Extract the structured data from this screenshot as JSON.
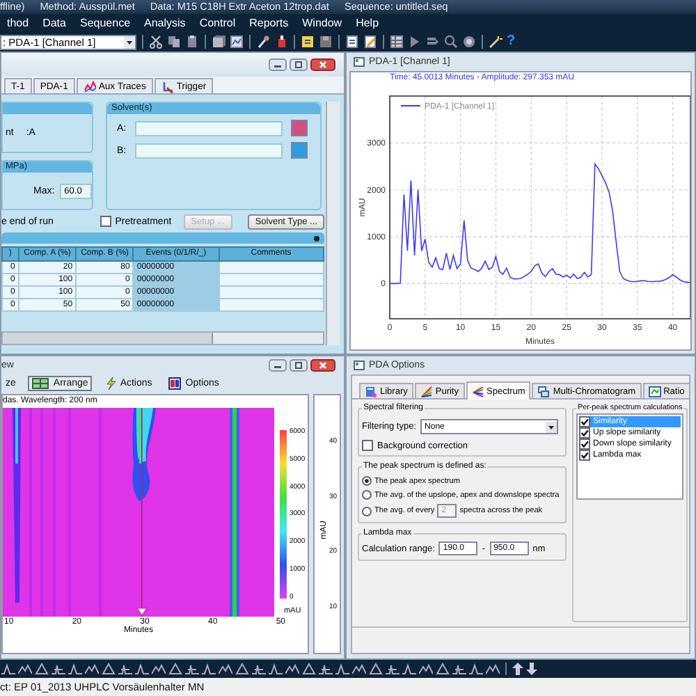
{
  "title_bar": {
    "segments": [
      "ffline)",
      "Method: Ausspül.met",
      "Data: M15 C18H Extr Aceton 12trop.dat",
      "Sequence: untitled.seq"
    ]
  },
  "menu": [
    "thod",
    "Data",
    "Sequence",
    "Analysis",
    "Control",
    "Reports",
    "Window",
    "Help"
  ],
  "toolbar": {
    "channel": ": PDA-1 [Channel 1]",
    "help": "?"
  },
  "method_window": {
    "tabs": [
      {
        "label": "T-1",
        "kind": "plain",
        "selected": false
      },
      {
        "label": "PDA-1",
        "kind": "plain",
        "selected": false
      },
      {
        "label": "Aux Traces",
        "kind": "traces",
        "selected": false
      },
      {
        "label": "Trigger",
        "kind": "trigger",
        "selected": false
      }
    ],
    "eluent": {
      "label": "nt",
      "value": ":A"
    },
    "pressure": {
      "header": "MPa)",
      "max_label": "Max:",
      "max_value": "60.0"
    },
    "solvents": {
      "header": "Solvent(s)",
      "rows": [
        {
          "label": "A:",
          "color": "#d44f86"
        },
        {
          "label": "B:",
          "color": "#2f9be0"
        }
      ]
    },
    "end_of_run": "e end of run",
    "pretreatment": {
      "label": "Pretreatment",
      "checked": false
    },
    "buttons": [
      {
        "label": "Setup ...",
        "disabled": true
      },
      {
        "label": "Solvent Type ...",
        "disabled": false
      }
    ],
    "table": {
      "columns": [
        ")",
        "Comp. A (%)",
        "Comp. B (%)",
        "Events (0/1/R/_)",
        "Comments"
      ],
      "rows": [
        [
          "0",
          "20",
          "80",
          "00000000"
        ],
        [
          "0",
          "100",
          "0",
          "00000000"
        ],
        [
          "0",
          "100",
          "0",
          "00000000"
        ],
        [
          "0",
          "50",
          "50",
          "00000000"
        ]
      ]
    }
  },
  "chart_window": {
    "title": "PDA-1 [Channel 1]",
    "info": "Time:  45.0013 Minutes - Amplitude:  297.353 mAU",
    "chart_data": {
      "type": "line",
      "xlabel": "Minutes",
      "ylabel": "mAU",
      "x": [
        0,
        0.5,
        1,
        1.5,
        2,
        2.5,
        3,
        3.5,
        4,
        4.5,
        5,
        5.5,
        6,
        6.5,
        7,
        7.5,
        8,
        8.5,
        9,
        9.5,
        10,
        10.5,
        11,
        11.5,
        12,
        12.5,
        13,
        13.5,
        14,
        14.5,
        15,
        15.5,
        16,
        16.5,
        17,
        17.5,
        18,
        18.5,
        19,
        19.5,
        20,
        20.5,
        21,
        21.5,
        22,
        22.5,
        23,
        23.5,
        24,
        24.5,
        25,
        25.5,
        26,
        26.5,
        27,
        27.5,
        28,
        28.5,
        29,
        29.5,
        30,
        30.5,
        31,
        31.5,
        32,
        32.5,
        33,
        33.5,
        34,
        34.5,
        35,
        35.5,
        36,
        36.5,
        37,
        37.5,
        38,
        38.5,
        39,
        39.5,
        40,
        40.5,
        41,
        41.5,
        42,
        42.5
      ],
      "series": [
        {
          "name": "PDA-1 [Channel 1]",
          "color": "#3b3bf0",
          "values": [
            0,
            0,
            0,
            10,
            1900,
            700,
            2200,
            600,
            2000,
            700,
            950,
            450,
            350,
            550,
            320,
            300,
            650,
            300,
            600,
            320,
            420,
            1350,
            500,
            330,
            300,
            260,
            330,
            480,
            300,
            350,
            580,
            260,
            200,
            330,
            140,
            100,
            100,
            110,
            150,
            200,
            260,
            380,
            420,
            220,
            150,
            260,
            320,
            200,
            190,
            140,
            180,
            120,
            200,
            110,
            130,
            240,
            140,
            190,
            2550,
            2450,
            2300,
            2150,
            1950,
            1550,
            900,
            260,
            110,
            70,
            50,
            40,
            50,
            60,
            60,
            50,
            40,
            50,
            50,
            60,
            90,
            130,
            190,
            140,
            80,
            40,
            30,
            20
          ]
        }
      ],
      "grid": true,
      "xlim": [
        0,
        42.5
      ],
      "ylim": [
        -750,
        4000
      ],
      "xticks": [
        0,
        5,
        10,
        15,
        20,
        25,
        30,
        35,
        40
      ],
      "yticks": [
        0,
        1000,
        2000,
        3000
      ]
    }
  },
  "view3d": {
    "title": "ew",
    "tools": [
      {
        "label": "ze",
        "kind": "plain",
        "pressed": false
      },
      {
        "label": "Arrange",
        "kind": "arrange",
        "pressed": true
      },
      {
        "label": "Actions",
        "kind": "actions",
        "pressed": false
      },
      {
        "label": "Options",
        "kind": "options",
        "pressed": false
      }
    ],
    "info": "das. Wavelength: 200 nm",
    "xticks": [
      "10",
      "20",
      "30",
      "40",
      "50"
    ],
    "xlabel": "Minutes",
    "colorbar": {
      "ticks": [
        "6000",
        "5000",
        "4000",
        "3000",
        "2000",
        "1000",
        "0"
      ],
      "unit": "mAU"
    },
    "side_axis": {
      "ticks": [
        "40",
        "30",
        "20",
        "10"
      ],
      "label": "mAU"
    }
  },
  "pda_options": {
    "title": "PDA Options",
    "tabs": [
      {
        "label": "Library",
        "kind": "library",
        "selected": false
      },
      {
        "label": "Purity",
        "kind": "purity",
        "selected": false
      },
      {
        "label": "Spectrum",
        "kind": "spectrum",
        "selected": true
      },
      {
        "label": "Multi-Chromatogram",
        "kind": "multi",
        "selected": false
      },
      {
        "label": "Ratio",
        "kind": "ratio",
        "selected": false
      }
    ],
    "spectral_filtering": {
      "legend": "Spectral filtering",
      "filter_label": "Filtering type:",
      "filter_value": "None",
      "background": {
        "label": "Background correction",
        "checked": false
      }
    },
    "peak_spectrum": {
      "legend": "The peak spectrum is defined as:",
      "options": [
        {
          "kind": "plain",
          "label": "The peak apex spectrum",
          "selected": true
        },
        {
          "kind": "plain",
          "label": "The avg. of the upslope, apex and downslope spectra",
          "selected": false
        },
        {
          "kind": "count",
          "label": "The avg. of every",
          "value": "2",
          "disabled": true,
          "label_after": "spectra across the peak",
          "selected": false
        }
      ]
    },
    "lambda_max": {
      "legend": "Lambda max",
      "label": "Calculation range:",
      "from": "190.0",
      "separator": "-",
      "to": "950.0",
      "unit": "nm"
    },
    "per_peak": {
      "legend": "Per-peak spectrum calculations",
      "items": [
        {
          "label": "Similarity",
          "checked": true,
          "selected": true
        },
        {
          "label": "Up slope similarity",
          "checked": true,
          "selected": false
        },
        {
          "label": "Down slope similarity",
          "checked": true,
          "selected": false
        },
        {
          "label": "Lambda max",
          "checked": true,
          "selected": false
        }
      ]
    }
  },
  "status": "ct: EP 01_2013 UHPLC Vorsäulenhalter MN"
}
